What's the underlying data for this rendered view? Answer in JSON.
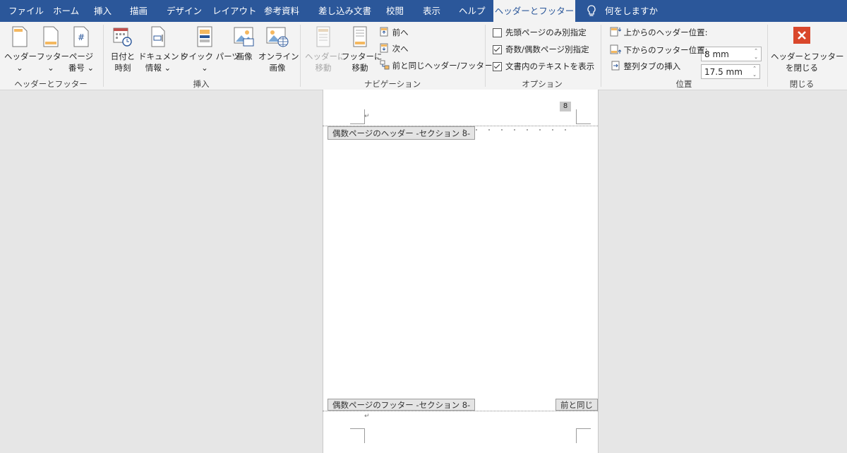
{
  "tabs": [
    "ファイル",
    "ホーム",
    "挿入",
    "描画",
    "デザイン",
    "レイアウト",
    "参考資料",
    "差し込み文書",
    "校閲",
    "表示",
    "ヘルプ",
    "ヘッダーとフッター"
  ],
  "tell_me": "何をしますか",
  "ribbon": {
    "hf_group": {
      "label": "ヘッダーとフッター",
      "header": "ヘッダー",
      "footer": "フッター",
      "page_number_l1": "ページ",
      "page_number_l2": "番号"
    },
    "insert_group": {
      "label": "挿入",
      "date_l1": "日付と",
      "date_l2": "時刻",
      "docinfo_l1": "ドキュメント",
      "docinfo_l2": "情報",
      "quickparts": "クイック パーツ",
      "picture": "画像",
      "online_l1": "オンライン",
      "online_l2": "画像"
    },
    "nav_group": {
      "label": "ナビゲーション",
      "goto_header_l1": "ヘッダーに",
      "goto_header_l2": "移動",
      "goto_footer_l1": "フッターに",
      "goto_footer_l2": "移動",
      "previous": "前へ",
      "next": "次へ",
      "link_previous": "前と同じヘッダー/フッター"
    },
    "options_group": {
      "label": "オプション",
      "first_page": "先頭ページのみ別指定",
      "odd_even": "奇数/偶数ページ別指定",
      "show_text": "文書内のテキストを表示",
      "first_page_checked": false,
      "odd_even_checked": true,
      "show_text_checked": true
    },
    "position_group": {
      "label": "位置",
      "header_from_top": "上からのヘッダー位置:",
      "header_value": "8 mm",
      "footer_from_bottom": "下からのフッター位置:",
      "footer_value": "17.5 mm",
      "align_tab": "整列タブの挿入"
    },
    "close_group": {
      "label": "閉じる",
      "close_l1": "ヘッダーとフッター",
      "close_l2": "を閉じる"
    }
  },
  "document": {
    "header_tag": "偶数ページのヘッダー -セクション 8-",
    "footer_tag": "偶数ページのフッター -セクション 8-",
    "same_as_previous": "前と同じ",
    "page_number": "8",
    "para_mark": "↵"
  },
  "colors": {
    "tab_bar": "#2b579a",
    "ribbon": "#f3f3f3",
    "canvas": "#e6e6e6",
    "close_red": "#d9472b"
  }
}
